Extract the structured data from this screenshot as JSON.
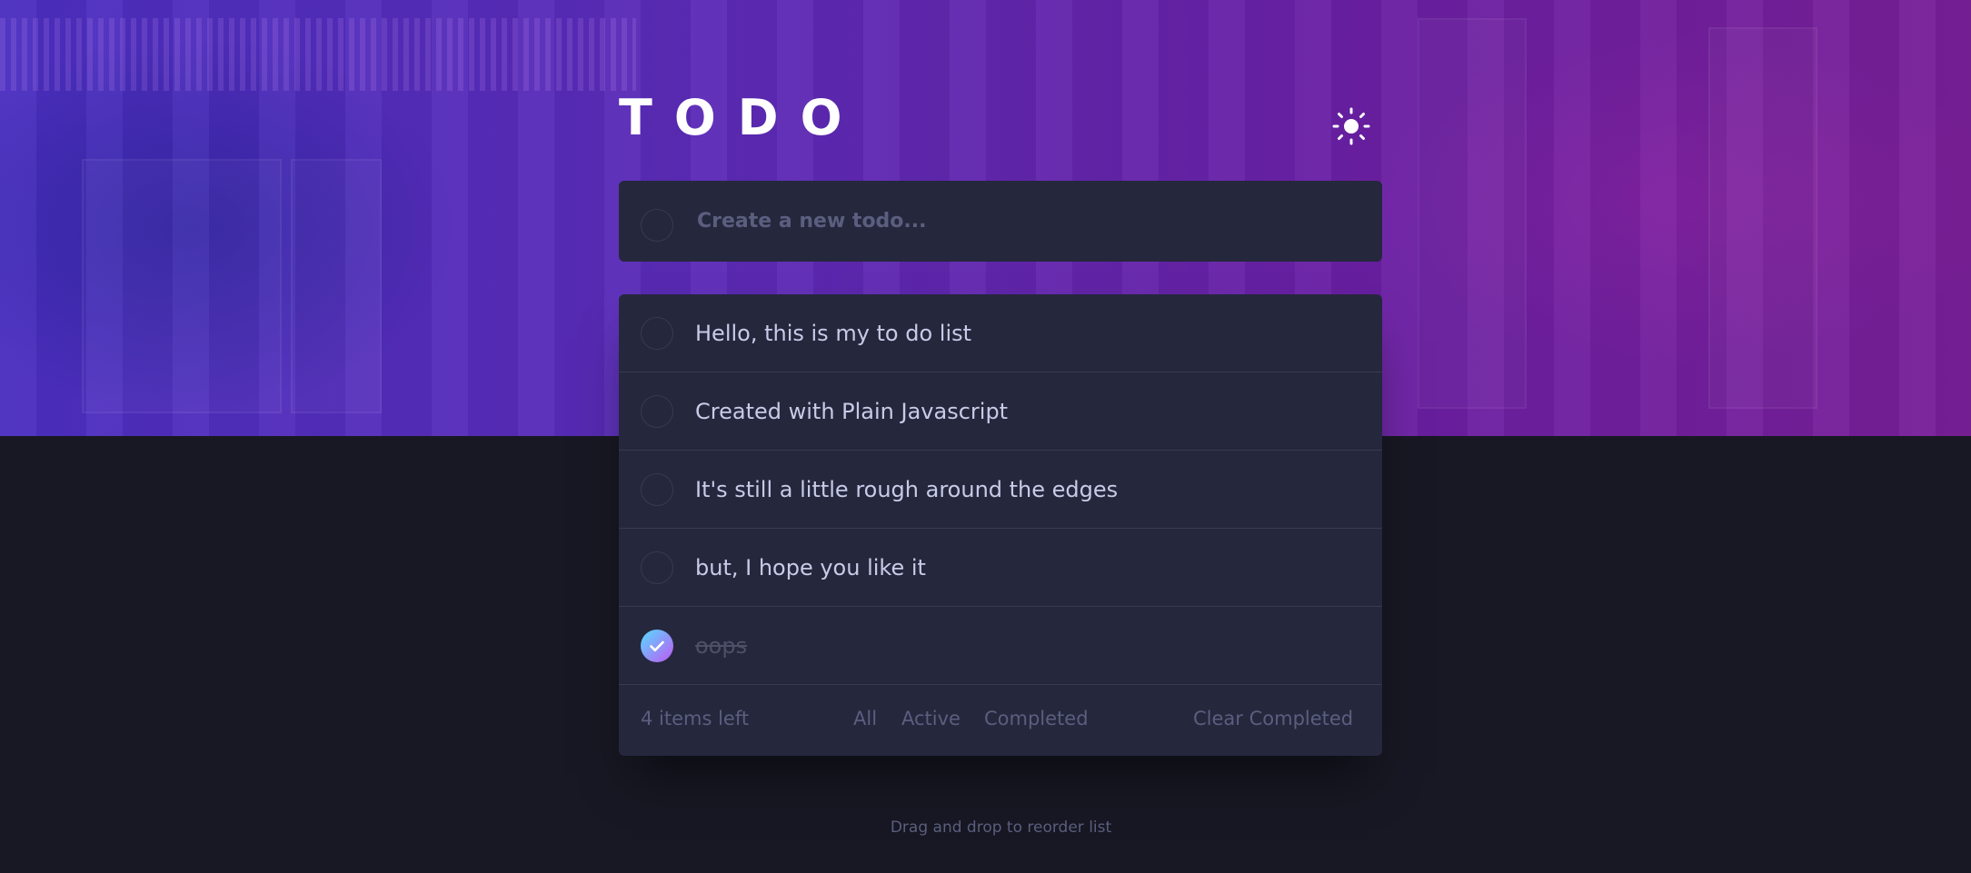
{
  "app": {
    "title": "TODO",
    "theme_toggle_icon": "sun-icon"
  },
  "create": {
    "placeholder": "Create a new todo...",
    "value": ""
  },
  "todos": [
    {
      "text": "Hello, this is my to do list",
      "completed": false
    },
    {
      "text": "Created with Plain Javascript",
      "completed": false
    },
    {
      "text": "It's still a little rough around the edges",
      "completed": false
    },
    {
      "text": "but, I hope you like it",
      "completed": false
    },
    {
      "text": "oops",
      "completed": true
    }
  ],
  "footer": {
    "items_left": "4 items left",
    "filters": [
      "All",
      "Active",
      "Completed"
    ],
    "clear_label": "Clear Completed"
  },
  "hint": "Drag and drop to reorder list",
  "colors": {
    "page_bg": "#171823",
    "card_bg": "#25273d",
    "divider": "#393a4b",
    "text": "#c8cbe7",
    "muted_text": "#5b5e7e",
    "check_gradient_start": "#55ddff",
    "check_gradient_end": "#c058f3"
  }
}
